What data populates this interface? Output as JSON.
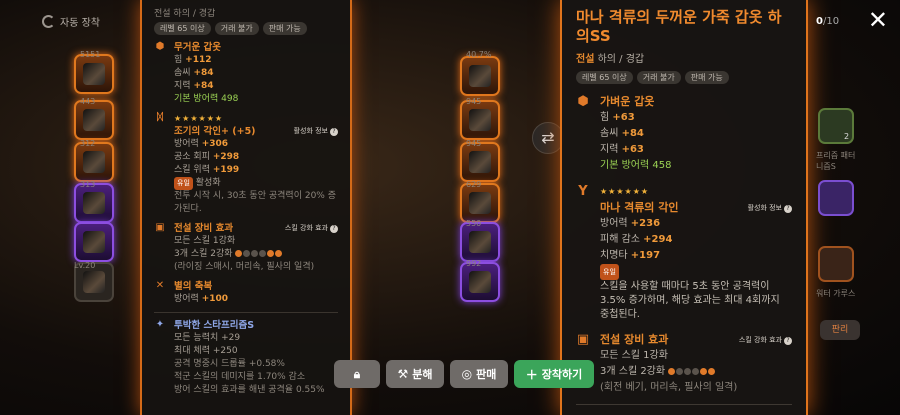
{
  "header": {
    "auto_equip_label": "자동 장착",
    "inventory_count_current": "0",
    "inventory_count_max": "/10",
    "close_icon": "close-icon"
  },
  "left_slots": [
    {
      "count": "5151",
      "rarity": "orange"
    },
    {
      "count": "443",
      "rarity": "orange"
    },
    {
      "count": "312",
      "rarity": "orange"
    },
    {
      "count": "313",
      "rarity": "purple"
    },
    {
      "count": "",
      "rarity": "purple"
    },
    {
      "count": "Lv.20",
      "rarity": "dark"
    }
  ],
  "left_panel": {
    "grade_line": "전설 하의 / 경갑",
    "tags": [
      "레벨 65 이상",
      "거래 불가",
      "판매 가능"
    ],
    "armor": {
      "title": "무거운 갑옷",
      "stats": [
        {
          "name": "힘",
          "value": "+112"
        },
        {
          "name": "솜씨",
          "value": "+84"
        },
        {
          "name": "지력",
          "value": "+84"
        }
      ],
      "base_defense_label": "기본 방어력",
      "base_defense_value": "498"
    },
    "engrave": {
      "stars": "★★★★★★",
      "title": "조기의 각인+ (+5)",
      "info_link": "활성화 정보",
      "stats": [
        {
          "name": "방어력",
          "value": "+306"
        },
        {
          "name": "공소 회피",
          "value": "+298"
        },
        {
          "name": "스킬 위력",
          "value": "+199"
        }
      ],
      "badge": "유일",
      "badge_text": "활성화",
      "desc": "전투 시작 시, 30초 동안 공격력이 20% 증가된다."
    },
    "set_effect": {
      "title": "전설 장비 효과",
      "info_link": "스킬 강화 효과",
      "line1": "모든 스킬 1강화",
      "line2": "3개 스킬 2강화",
      "line3": "(라이징 스매시, 머리속, 필사의 일격)"
    },
    "blessing": {
      "title": "별의 축복",
      "stat_name": "방어력",
      "stat_value": "+100"
    },
    "extra": {
      "title": "투박한 스타프리즘S",
      "lines": [
        "모든 능력치 +29",
        "최대 체력 +250",
        "공격 명중시 드롭률 +0.58%",
        "적군 스킬의 데미지를 1.70% 감소",
        "방어 스킬의 효과를 해낸 공격율 0.55%"
      ]
    }
  },
  "mid_slots": [
    {
      "count": "40.7%"
    },
    {
      "count": "945"
    },
    {
      "count": "945"
    },
    {
      "count": "629"
    },
    {
      "count": "550"
    },
    {
      "count": "992"
    }
  ],
  "right_panel": {
    "title": "마나 격류의 두꺼운 가죽 갑옷 하의SS",
    "grade_prefix": "전설",
    "grade_rest": "하의 / 경갑",
    "tags": [
      "레벨 65 이상",
      "거래 불가",
      "판매 가능"
    ],
    "armor": {
      "title": "가벼운 갑옷",
      "stats": [
        {
          "name": "힘",
          "value": "+63"
        },
        {
          "name": "솜씨",
          "value": "+84"
        },
        {
          "name": "지력",
          "value": "+63"
        }
      ],
      "base_defense_label": "기본 방어력",
      "base_defense_value": "458"
    },
    "engrave": {
      "stars": "★★★★★★",
      "title": "마나 격류의 각인",
      "info_link": "활성화 정보",
      "stats": [
        {
          "name": "방어력",
          "value": "+236"
        },
        {
          "name": "피해 감소",
          "value": "+294"
        },
        {
          "name": "치명타",
          "value": "+197"
        }
      ],
      "badge": "유일",
      "desc": "스킬을 사용할 때마다 5초 동안 공격력이 3.5% 증가하며, 해당 효과는 최대 4회까지 중첩된다."
    },
    "set_effect": {
      "title": "전설 장비 효과",
      "info_link": "스킬 강화 효과",
      "line1": "모든 스킬 1강화",
      "line2": "3개 스킬 2강화",
      "line3": "(회전 베기, 머리속, 필사의 일격)"
    }
  },
  "right_edge": {
    "slot2_count": "2",
    "slot2_label": "프리즘 패터니즘S",
    "slot4_label": "워터 가루스",
    "sell_label": "판리"
  },
  "actions": {
    "lock_icon": "lock-icon",
    "dismantle_label": "분해",
    "sell_label": "판매",
    "equip_label": "장착하기"
  },
  "colors": {
    "legend_orange": "#e0781e",
    "highlight": "#f09a3a",
    "green_stat": "#9bd254",
    "equip_button": "#3ba55a"
  }
}
